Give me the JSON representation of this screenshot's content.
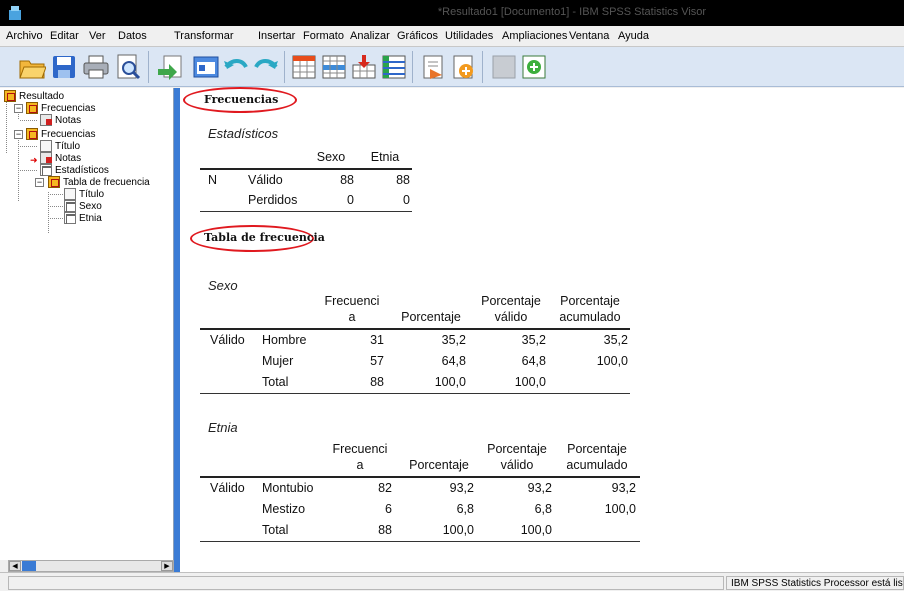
{
  "window": {
    "title": "*Resultado1 [Documento1] - IBM SPSS Statistics Visor"
  },
  "menu": [
    "Archivo",
    "Editar",
    "Ver",
    "Datos",
    "Transformar",
    "Insertar",
    "Formato",
    "Analizar",
    "Gráficos",
    "Utilidades",
    "Ampliaciones",
    "Ventana",
    "Ayuda"
  ],
  "toolbar_icons": [
    "open-icon",
    "save-icon",
    "print-icon",
    "print-preview-icon",
    "export-icon",
    "recall-dialog-icon",
    "undo-icon",
    "redo-icon",
    "goto-data-icon",
    "goto-case-icon",
    "goto-variable-icon",
    "variables-icon",
    "insert-output-icon",
    "designate-window-icon",
    "chart-builder-icon",
    "add-item-icon"
  ],
  "outline": {
    "items": [
      {
        "label": "Resultado",
        "icon": "log-book-icon"
      },
      {
        "label": "Frecuencias",
        "icon": "procedure-book-icon"
      },
      {
        "label": "Notas",
        "icon": "notes-icon"
      },
      {
        "label": "Frecuencias",
        "icon": "procedure-book-icon"
      },
      {
        "label": "Título",
        "icon": "title-icon"
      },
      {
        "label": "Notas",
        "icon": "notes-icon"
      },
      {
        "label": "Estadísticos",
        "icon": "table-icon"
      },
      {
        "label": "Tabla de frecuencia",
        "icon": "procedure-book-icon"
      },
      {
        "label": "Título",
        "icon": "title-icon"
      },
      {
        "label": "Sexo",
        "icon": "table-icon"
      },
      {
        "label": "Etnia",
        "icon": "table-icon"
      }
    ]
  },
  "output": {
    "heading1": "Frecuencias",
    "stats": {
      "caption": "Estadísticos",
      "col_headers": [
        "Sexo",
        "Etnia"
      ],
      "n_label": "N",
      "rows": [
        {
          "label": "Válido",
          "sexo": "88",
          "etnia": "88"
        },
        {
          "label": "Perdidos",
          "sexo": "0",
          "etnia": "0"
        }
      ]
    },
    "heading2": "Tabla de frecuencia",
    "sexo": {
      "caption": "Sexo",
      "headers": {
        "freq_1": "Frecuenci",
        "freq_2": "a",
        "pct": "Porcentaje",
        "valid_1": "Porcentaje",
        "valid_2": "válido",
        "cum_1": "Porcentaje",
        "cum_2": "acumulado"
      },
      "group_label": "Válido",
      "rows": [
        {
          "label": "Hombre",
          "freq": "31",
          "pct": "35,2",
          "valid": "35,2",
          "cum": "35,2"
        },
        {
          "label": "Mujer",
          "freq": "57",
          "pct": "64,8",
          "valid": "64,8",
          "cum": "100,0"
        },
        {
          "label": "Total",
          "freq": "88",
          "pct": "100,0",
          "valid": "100,0",
          "cum": ""
        }
      ]
    },
    "etnia": {
      "caption": "Etnia",
      "headers": {
        "freq_1": "Frecuenci",
        "freq_2": "a",
        "pct": "Porcentaje",
        "valid_1": "Porcentaje",
        "valid_2": "válido",
        "cum_1": "Porcentaje",
        "cum_2": "acumulado"
      },
      "group_label": "Válido",
      "rows": [
        {
          "label": "Montubio",
          "freq": "82",
          "pct": "93,2",
          "valid": "93,2",
          "cum": "93,2"
        },
        {
          "label": "Mestizo",
          "freq": "6",
          "pct": "6,8",
          "valid": "6,8",
          "cum": "100,0"
        },
        {
          "label": "Total",
          "freq": "88",
          "pct": "100,0",
          "valid": "100,0",
          "cum": ""
        }
      ]
    }
  },
  "status": {
    "right_text": "IBM SPSS Statistics Processor está listo"
  },
  "colors": {
    "accent": "#3a7bd5",
    "highlight": "#e0191f",
    "toolbar_bg": "#dbe6f4"
  }
}
